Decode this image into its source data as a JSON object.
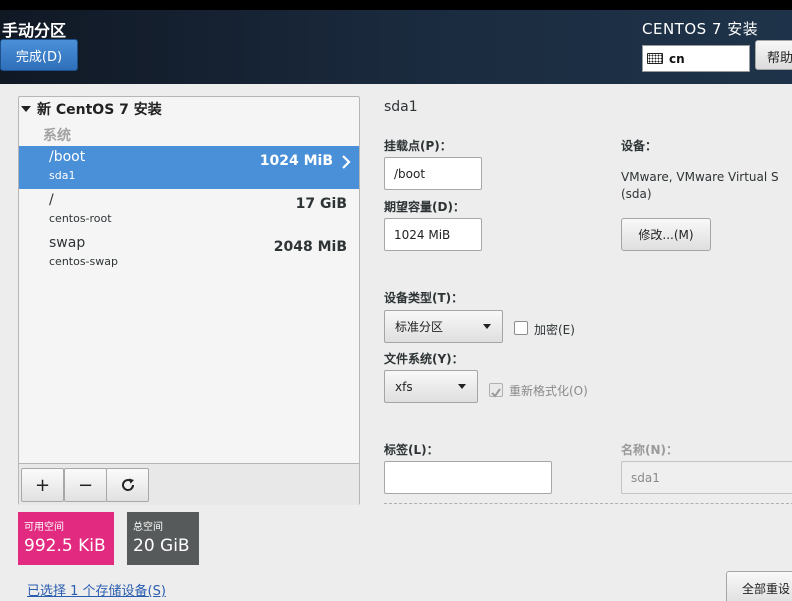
{
  "header": {
    "page_title": "手动分区",
    "done_label": "完成(D)",
    "product_title": "CENTOS 7 安装",
    "keyboard_layout": "cn",
    "help_label": "帮助"
  },
  "partitions": {
    "install_title": "新 CentOS 7 安装",
    "group_label": "系统",
    "items": [
      {
        "mount": "/boot",
        "device": "sda1",
        "size": "1024 MiB"
      },
      {
        "mount": "/",
        "device": "centos-root",
        "size": "17 GiB"
      },
      {
        "mount": "swap",
        "device": "centos-swap",
        "size": "2048 MiB"
      }
    ],
    "toolbar": {
      "add": "+",
      "remove": "−",
      "refresh": "refresh-icon"
    }
  },
  "space": {
    "available_label": "可用空间",
    "available_value": "992.5 KiB",
    "total_label": "总空间",
    "total_value": "20 GiB",
    "storage_link": "已选择 1 个存储设备(S)"
  },
  "detail": {
    "title": "sda1",
    "mount_point_label": "挂载点(P)：",
    "mount_point_value": "/boot",
    "capacity_label": "期望容量(D)：",
    "capacity_value": "1024 MiB",
    "device_label": "设备：",
    "device_value": "VMware, VMware Virtual S (sda)",
    "modify_label": "修改...(M)",
    "device_type_label": "设备类型(T)：",
    "device_type_value": "标准分区",
    "encrypt_label": "加密(E)",
    "filesystem_label": "文件系统(Y)：",
    "filesystem_value": "xfs",
    "reformat_label": "重新格式化(O)",
    "tag_label": "标签(L)：",
    "tag_value": "",
    "name_label": "名称(N)：",
    "name_value": "sda1",
    "reset_all_label": "全部重设"
  },
  "colors": {
    "selected_row": "#4a90d9",
    "available_space": "#e22a80",
    "total_space": "#575a5a",
    "link": "#2a5db0"
  }
}
